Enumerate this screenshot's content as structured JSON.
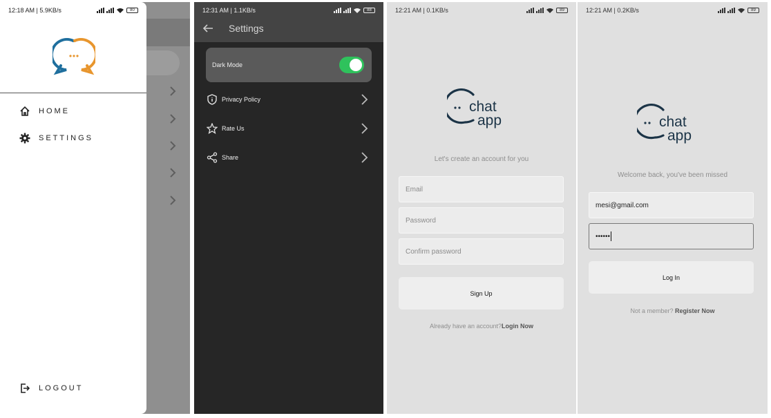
{
  "drawer_screen": {
    "status": {
      "time": "12:18 AM",
      "speed": "5.9KB/s",
      "battery": "80"
    },
    "items": [
      {
        "label": "HOME"
      },
      {
        "label": "SETTINGS"
      }
    ],
    "logout_label": "LOGOUT"
  },
  "settings_screen": {
    "status": {
      "time": "12:31 AM",
      "speed": "1.1KB/s",
      "battery": "88"
    },
    "title": "Settings",
    "dark_mode": {
      "label": "Dark Mode",
      "enabled": true
    },
    "items": [
      {
        "label": "Privacy Policy"
      },
      {
        "label": "Rate Us"
      },
      {
        "label": "Share"
      }
    ]
  },
  "signup_screen": {
    "status": {
      "time": "12:21 AM",
      "speed": "0.1KB/s",
      "battery": "89"
    },
    "logo": {
      "word1": "chat",
      "word2": "app"
    },
    "subtitle": "Let's create an account for you",
    "email_placeholder": "Email",
    "password_placeholder": "Password",
    "confirm_placeholder": "Confirm password",
    "button_label": "Sign Up",
    "footer_text": "Already have an account?",
    "footer_link": "Login Now"
  },
  "login_screen": {
    "status": {
      "time": "12:21 AM",
      "speed": "0.2KB/s",
      "battery": "89"
    },
    "logo": {
      "word1": "chat",
      "word2": "app"
    },
    "subtitle": "Welcome back, you've been missed",
    "email_value": "mesi@gmail.com",
    "password_value": "••••••",
    "button_label": "Log In",
    "footer_text": "Not a member?",
    "footer_link": "Register Now"
  },
  "colors": {
    "accent_green": "#2fc25c",
    "logo_blue": "#1f6f9e",
    "logo_orange": "#e8962e",
    "logo_navy": "#1c3447"
  }
}
